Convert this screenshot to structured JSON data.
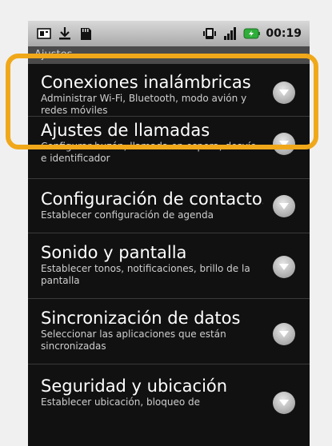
{
  "statusbar": {
    "time": "00:19",
    "left_icons": [
      "sim-card-icon",
      "download-icon",
      "sd-card-icon"
    ],
    "right_icons": [
      "vibrate-icon",
      "signal-icon",
      "battery-charging-icon"
    ]
  },
  "titlebar": {
    "title": "Ajustes"
  },
  "settings": [
    {
      "title": "Conexiones inalámbricas",
      "subtitle": "Administrar Wi-Fi, Bluetooth, modo avión y redes móviles"
    },
    {
      "title": "Ajustes de llamadas",
      "subtitle": "Configurar buzón, llamada en espera, desvío e identificador"
    },
    {
      "title": "Configuración de contactos",
      "subtitle": "Establecer configuración de agenda"
    },
    {
      "title": "Sonido y pantalla",
      "subtitle": "Establecer tonos, notificaciones, brillo de la pantalla"
    },
    {
      "title": "Sincronización de datos",
      "subtitle": "Seleccionar las aplicaciones que están sincronizadas"
    },
    {
      "title": "Seguridad y ubicación",
      "subtitle": "Establecer ubicación, bloqueo de"
    }
  ],
  "colors": {
    "highlight": "#f0a81a",
    "background": "#111111",
    "statusbar": "#b5b5b5"
  }
}
